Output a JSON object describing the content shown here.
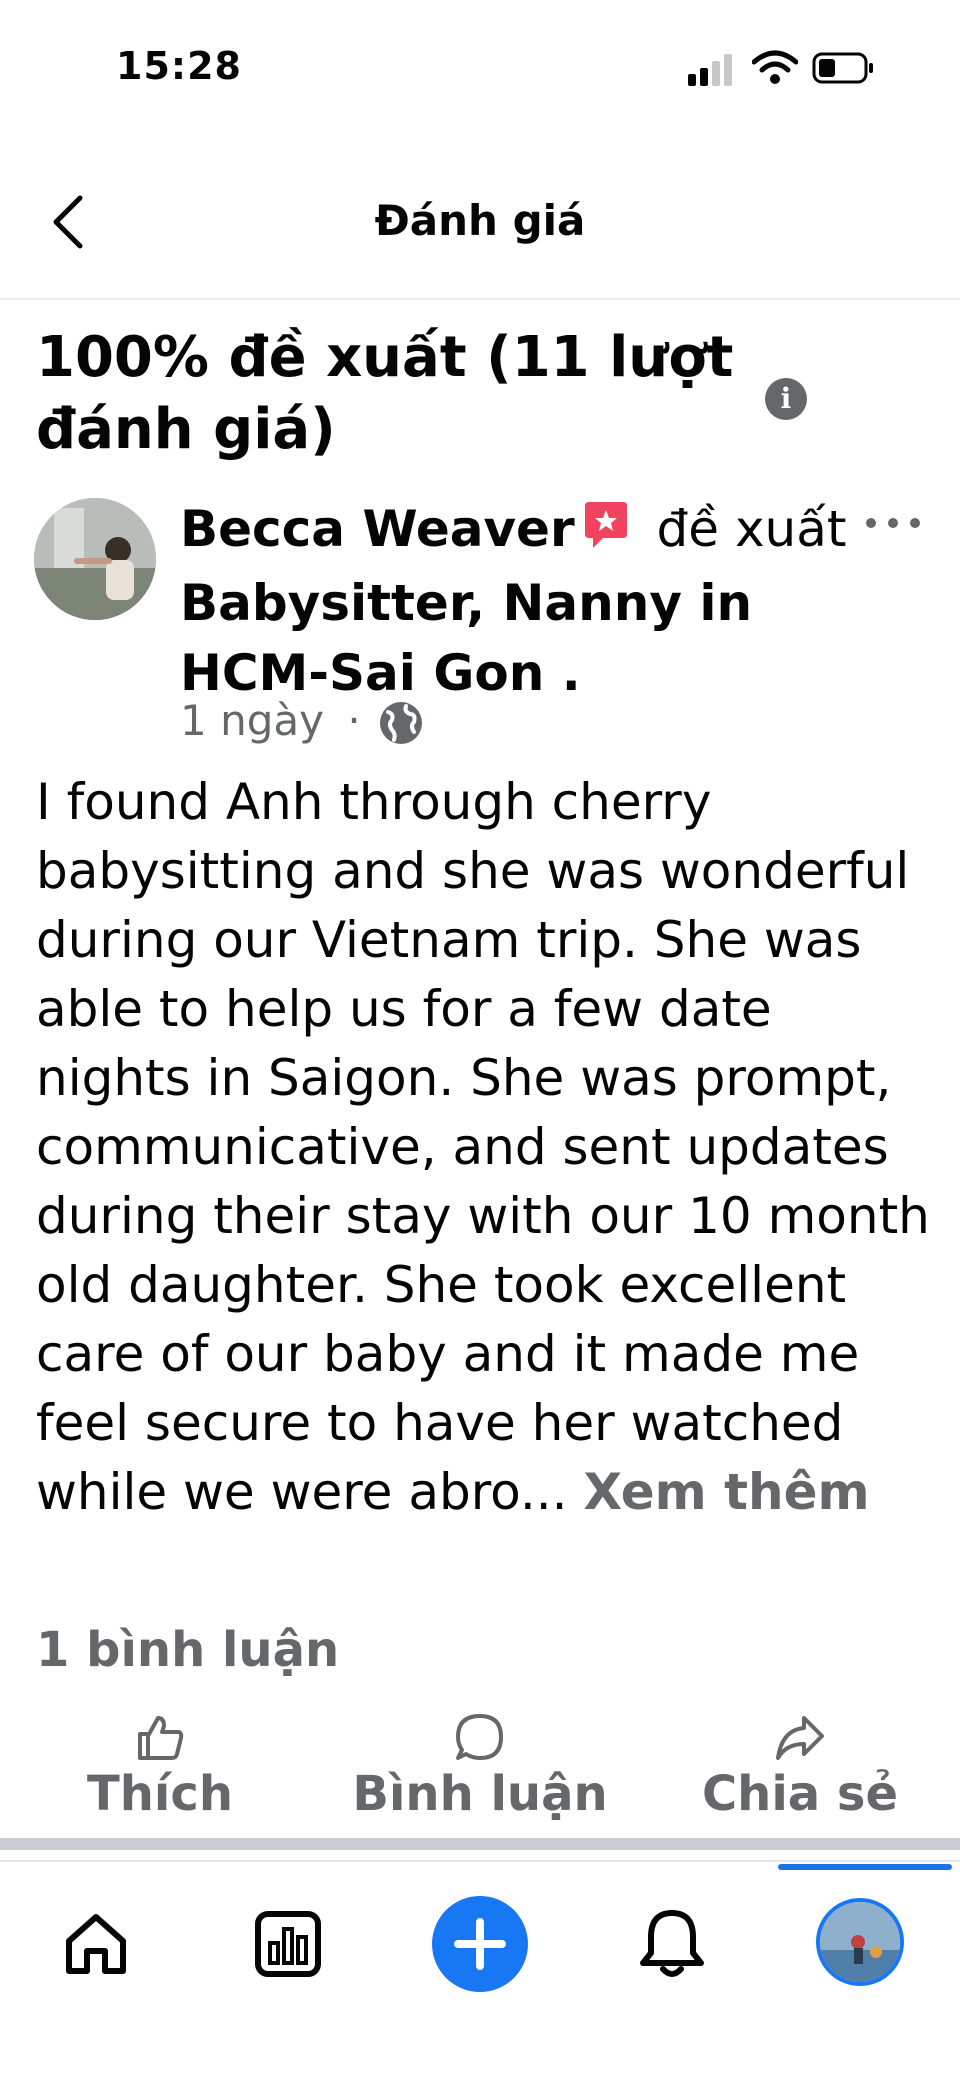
{
  "status_bar": {
    "time": "15:28"
  },
  "nav": {
    "title": "Đánh giá",
    "back_icon": "chevron-left-icon"
  },
  "summary": {
    "heading": "100% đề xuất (11 lượt đánh giá)",
    "info_icon": "info-icon"
  },
  "post": {
    "author": "Becca Weaver",
    "verb": "đề xuất",
    "page_name": "Babysitter, Nanny in HCM-Sai Gon",
    "period": " .",
    "time": "1 ngày",
    "separator": "·",
    "audience_icon": "globe-icon",
    "body": "I found Anh through cherry babysitting and she was wonderful during our Vietnam trip.  She was able to help us for a few date nights in Saigon.  She was prompt, communicative, and sent updates during their stay with our 10 month old daughter.  She took excellent care of our baby and it made me feel secure to have her watched while we were abro...",
    "see_more": "Xem thêm",
    "comment_count": "1 bình luận"
  },
  "actions": {
    "like": "Thích",
    "comment": "Bình luận",
    "share": "Chia sẻ"
  },
  "tab_bar": [
    "home-icon",
    "dashboard-icon",
    "add-icon",
    "notifications-icon",
    "profile-avatar"
  ],
  "colors": {
    "accent": "#1877f2",
    "secondary_text": "#65676b",
    "badge": "#f3425f"
  }
}
